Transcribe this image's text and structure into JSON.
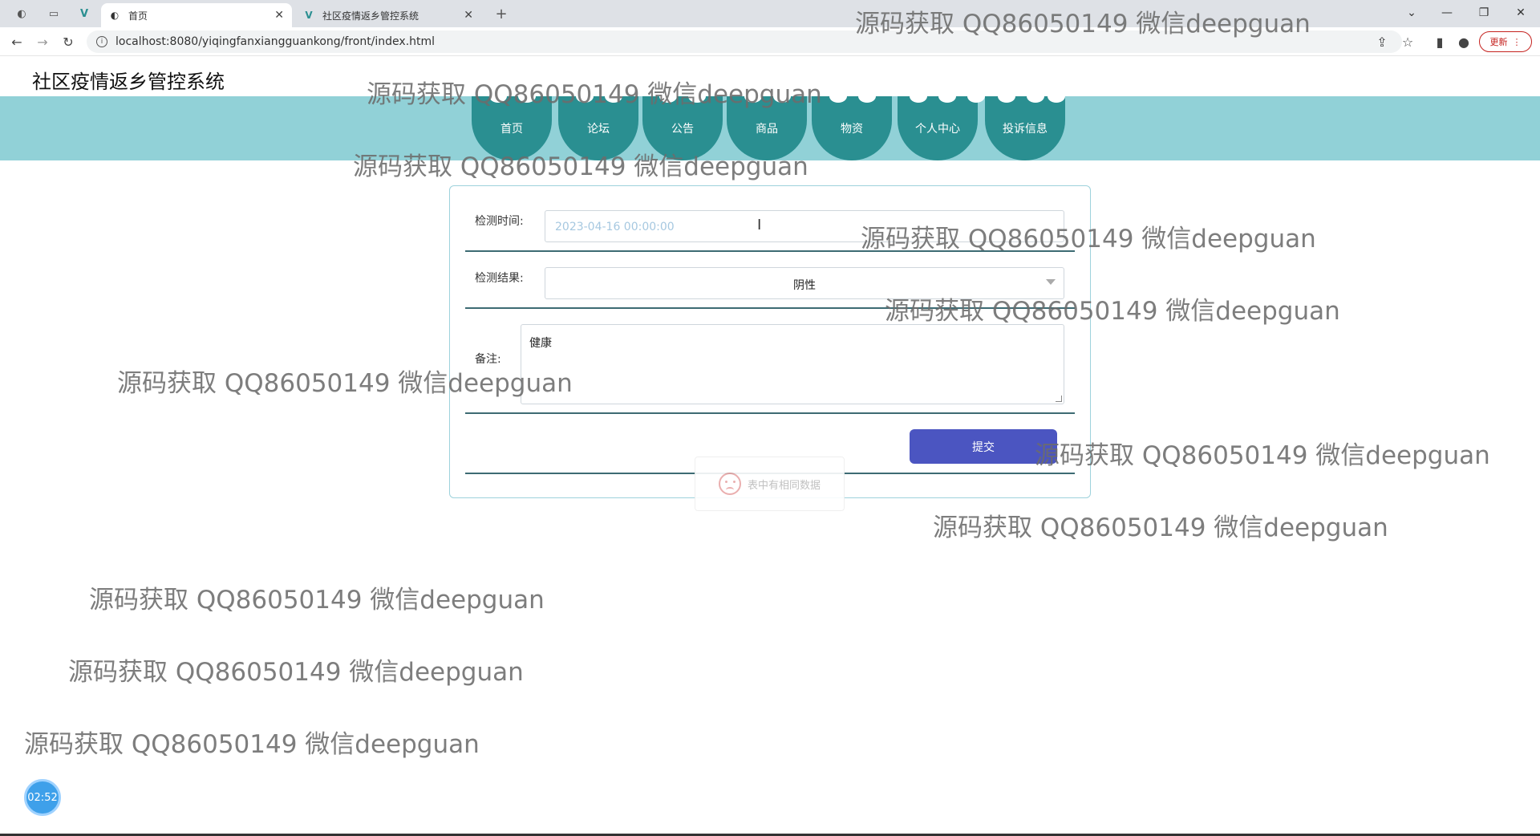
{
  "browser": {
    "tabs": [
      {
        "label": "首页",
        "active": true
      },
      {
        "label": "社区疫情返乡管控系统",
        "active": false
      }
    ],
    "url": "localhost:8080/yiqingfanxiangguankong/front/index.html",
    "update_label": "更新"
  },
  "site": {
    "title": "社区疫情返乡管控系统"
  },
  "nav": {
    "items": [
      "首页",
      "论坛",
      "公告",
      "商品",
      "物资",
      "个人中心",
      "投诉信息"
    ]
  },
  "form": {
    "time_label": "检测时间:",
    "time_value": "2023-04-16 00:00:00",
    "result_label": "检测结果:",
    "result_value": "阴性",
    "note_label": "备注:",
    "note_value": "健康",
    "submit_label": "提交"
  },
  "toast": {
    "message": "表中有相同数据"
  },
  "timer": {
    "value": "02:52"
  },
  "watermark": {
    "text": "源码获取 QQ86050149 微信deepguan"
  },
  "colors": {
    "nav_band": "#91d1d7",
    "nav_item": "#2a8f91",
    "submit": "#4b55c1",
    "card_border": "#9ed2dc"
  }
}
